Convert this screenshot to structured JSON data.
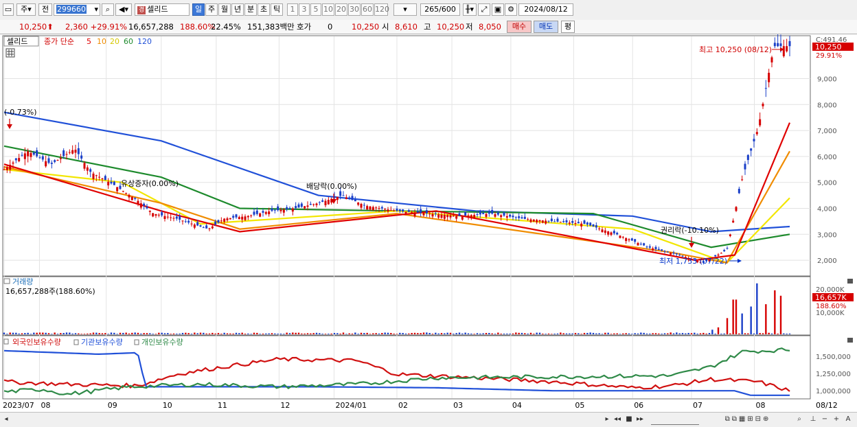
{
  "toolbar": {
    "period_select": "주",
    "prev_label": "전",
    "code": "299660",
    "name": "셀리드",
    "name_badge": "경",
    "periods": [
      "일",
      "주",
      "월",
      "년",
      "분",
      "초",
      "틱"
    ],
    "active_period": "일",
    "intervals": [
      "1",
      "3",
      "5",
      "10",
      "20",
      "30",
      "60",
      "120"
    ],
    "count": "265",
    "count_max": "/600",
    "date": "2024/08/12"
  },
  "quote": {
    "price": "10,250",
    "price_arrow": "⬆",
    "change": "2,360",
    "change_pct": "+29.91%",
    "volume": "16,657,288",
    "volume_ratio": "188.60%",
    "turnover": "22.45%",
    "amount": "151,383백만",
    "hoga_label": "호가",
    "hoga_value": "0",
    "hoga_price": "10,250",
    "open_label": "시",
    "open": "8,610",
    "high_label": "고",
    "high": "10,250",
    "low_label": "저",
    "low": "8,050",
    "buy_label": "매수",
    "sell_label": "매도",
    "eval_label": "평"
  },
  "price_panel": {
    "stock_tag": "셀리드",
    "legend_title": "종가 단순",
    "ma_periods": [
      "5",
      "10",
      "20",
      "60",
      "120"
    ],
    "colors": {
      "candle_up": "#d60000",
      "candle_down": "#1a3fc8",
      "ma5": "#e00000",
      "ma10": "#f08c00",
      "ma20": "#f2e600",
      "ma60": "#1d8a2c",
      "ma120": "#2050d8"
    },
    "right_top_label": "C:491.46",
    "current_price_tag": "10,250",
    "current_pct_tag": "29.91%",
    "annotation_high": "최고 10,250 (08/12)",
    "annotation_low": "최저 1,733 (07/22)",
    "annotation_start": "(-0.73%)",
    "annotation_capital": "유상증자(0.00%)",
    "annotation_dividend": "배당락(0.00%)",
    "annotation_rights": "권리락(-10.10%)",
    "y_ticks": [
      "9,000",
      "8,000",
      "7,000",
      "6,000",
      "5,000",
      "4,000",
      "3,000",
      "2,000"
    ]
  },
  "volume_panel": {
    "title": "거래량",
    "value_text": "16,657,288주(188.60%)",
    "y_ticks": [
      "20,000K",
      "10,000K"
    ],
    "current_tag": "16,657K",
    "current_pct": "188.60%"
  },
  "holdings_panel": {
    "legend": [
      "외국인보유수량",
      "기관보유수량",
      "개인보유수량"
    ],
    "colors": [
      "#d01010",
      "#2050d8",
      "#2f8a48"
    ],
    "y_ticks": [
      "1,500,000",
      "1,250,000",
      "1,000,000"
    ]
  },
  "x_axis": {
    "labels": [
      "2023/07",
      "08",
      "09",
      "10",
      "11",
      "12",
      "2024/01",
      "02",
      "03",
      "04",
      "05",
      "06",
      "07",
      "08"
    ],
    "right_label": "08/12"
  },
  "chart_data": {
    "type": "candlestick",
    "price_points": [
      [
        0,
        5500
      ],
      [
        0.03,
        6200
      ],
      [
        0.06,
        5700
      ],
      [
        0.09,
        6300
      ],
      [
        0.11,
        5400
      ],
      [
        0.14,
        4900
      ],
      [
        0.17,
        4300
      ],
      [
        0.19,
        3800
      ],
      [
        0.22,
        3600
      ],
      [
        0.26,
        3200
      ],
      [
        0.28,
        3600
      ],
      [
        0.31,
        3700
      ],
      [
        0.34,
        3900
      ],
      [
        0.37,
        4000
      ],
      [
        0.4,
        4200
      ],
      [
        0.43,
        4500
      ],
      [
        0.46,
        4100
      ],
      [
        0.5,
        3900
      ],
      [
        0.54,
        3800
      ],
      [
        0.58,
        3700
      ],
      [
        0.62,
        3800
      ],
      [
        0.66,
        3600
      ],
      [
        0.7,
        3500
      ],
      [
        0.74,
        3400
      ],
      [
        0.78,
        3000
      ],
      [
        0.82,
        2500
      ],
      [
        0.86,
        2200
      ],
      [
        0.89,
        1900
      ],
      [
        0.92,
        2400
      ],
      [
        0.94,
        5200
      ],
      [
        0.96,
        7100
      ],
      [
        0.98,
        10250
      ]
    ],
    "volume_points": [
      [
        0.9,
        2000
      ],
      [
        0.91,
        3000
      ],
      [
        0.92,
        7000
      ],
      [
        0.93,
        15000
      ],
      [
        0.94,
        9000
      ],
      [
        0.95,
        12000
      ],
      [
        0.96,
        22000
      ],
      [
        0.97,
        13000
      ],
      [
        0.98,
        19000
      ],
      [
        0.99,
        16657
      ]
    ],
    "ma_series": {
      "ma120": [
        [
          0,
          7700
        ],
        [
          0.2,
          6600
        ],
        [
          0.4,
          4500
        ],
        [
          0.6,
          3900
        ],
        [
          0.8,
          3700
        ],
        [
          0.9,
          3100
        ],
        [
          1.0,
          3300
        ]
      ],
      "ma60": [
        [
          0,
          6400
        ],
        [
          0.2,
          5200
        ],
        [
          0.3,
          4000
        ],
        [
          0.5,
          3900
        ],
        [
          0.75,
          3800
        ],
        [
          0.9,
          2500
        ],
        [
          1.0,
          3000
        ]
      ],
      "ma20": [
        [
          0,
          5500
        ],
        [
          0.15,
          5000
        ],
        [
          0.25,
          3400
        ],
        [
          0.5,
          3900
        ],
        [
          0.8,
          3200
        ],
        [
          0.92,
          1900
        ],
        [
          1.0,
          4400
        ]
      ],
      "ma10": [
        [
          0,
          5600
        ],
        [
          0.2,
          4200
        ],
        [
          0.3,
          3200
        ],
        [
          0.5,
          3800
        ],
        [
          0.85,
          2300
        ],
        [
          0.92,
          1900
        ],
        [
          1.0,
          6200
        ]
      ],
      "ma5": [
        [
          0,
          5700
        ],
        [
          0.2,
          3900
        ],
        [
          0.3,
          3100
        ],
        [
          0.55,
          3900
        ],
        [
          0.88,
          2000
        ],
        [
          0.93,
          2200
        ],
        [
          1.0,
          7300
        ]
      ]
    },
    "holdings": {
      "foreign": [
        [
          0,
          0.3
        ],
        [
          0.08,
          0.25
        ],
        [
          0.17,
          0.22
        ],
        [
          0.22,
          0.45
        ],
        [
          0.28,
          0.6
        ],
        [
          0.35,
          0.75
        ],
        [
          0.45,
          0.72
        ],
        [
          0.5,
          0.45
        ],
        [
          0.6,
          0.38
        ],
        [
          0.7,
          0.3
        ],
        [
          0.8,
          0.18
        ],
        [
          0.85,
          0.22
        ],
        [
          0.9,
          0.35
        ],
        [
          0.96,
          0.3
        ],
        [
          1.0,
          0.12
        ]
      ],
      "institution": [
        [
          0,
          0.92
        ],
        [
          0.12,
          0.85
        ],
        [
          0.17,
          0.88
        ],
        [
          0.18,
          0.2
        ],
        [
          0.25,
          0.2
        ],
        [
          0.4,
          0.2
        ],
        [
          0.55,
          0.18
        ],
        [
          0.7,
          0.12
        ],
        [
          0.93,
          0.12
        ],
        [
          0.95,
          0.03
        ],
        [
          1.0,
          0.03
        ]
      ],
      "individual": [
        [
          0,
          0.1
        ],
        [
          0.05,
          0.15
        ],
        [
          0.08,
          0.05
        ],
        [
          0.16,
          0.2
        ],
        [
          0.25,
          0.25
        ],
        [
          0.35,
          0.2
        ],
        [
          0.45,
          0.25
        ],
        [
          0.55,
          0.38
        ],
        [
          0.7,
          0.4
        ],
        [
          0.85,
          0.42
        ],
        [
          0.9,
          0.6
        ],
        [
          0.94,
          0.9
        ],
        [
          1.0,
          0.94
        ]
      ]
    }
  }
}
